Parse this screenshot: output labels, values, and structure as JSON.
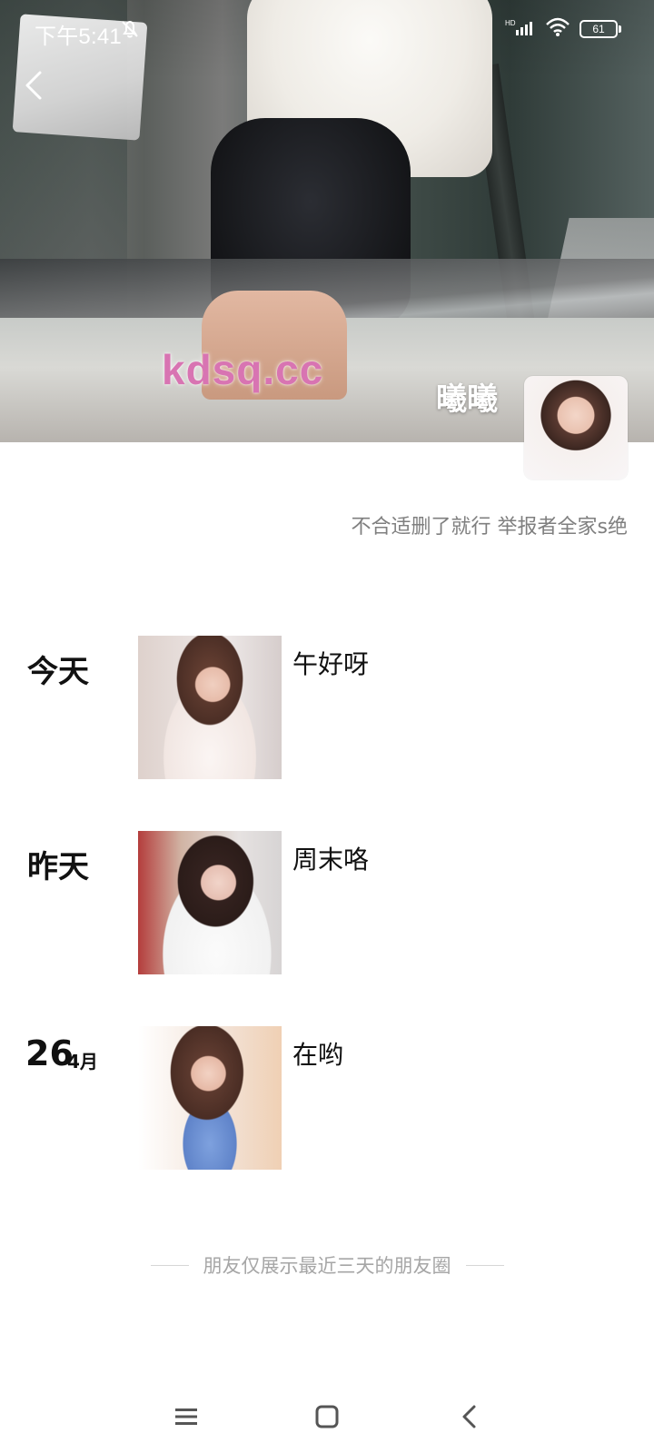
{
  "status_bar": {
    "time": "下午5:41",
    "battery": "61"
  },
  "profile": {
    "name": "曦曦",
    "signature": "不合适删了就行 举报者全家s绝"
  },
  "watermark": "kdsq.cc",
  "feed": [
    {
      "day_label": "今天",
      "text": "午好呀"
    },
    {
      "day_label": "昨天",
      "text": "周末咯"
    },
    {
      "date_num": "26",
      "date_month": "4月",
      "text": "在哟"
    }
  ],
  "footer_note": "朋友仅展示最近三天的朋友圈",
  "icons": {
    "back": "back-arrow-icon",
    "dnd": "bell-off-icon",
    "signal": "signal-icon",
    "wifi": "wifi-icon",
    "battery": "battery-icon",
    "nav_menu": "menu-icon",
    "nav_home": "home-square-icon",
    "nav_back": "back-triangle-icon"
  }
}
